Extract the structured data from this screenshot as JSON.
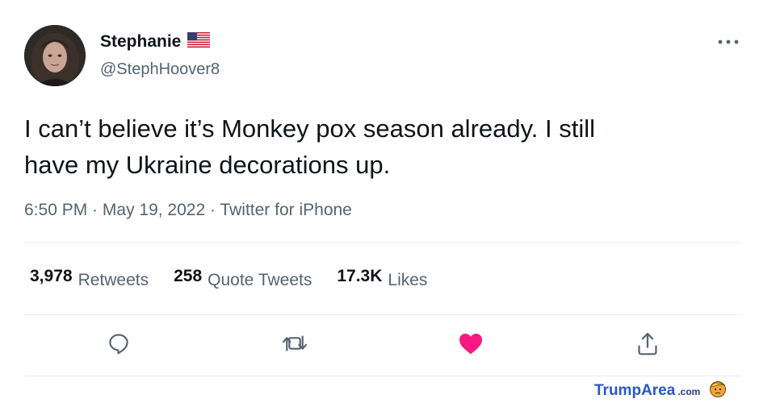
{
  "tweet": {
    "author": {
      "name": "Stephanie",
      "handle": "@StephHoover8"
    },
    "text_line1": "I can’t believe it’s Monkey pox season already. I still",
    "text_line2": "have my Ukraine decorations up.",
    "time": "6:50 PM",
    "date": "May 19, 2022",
    "source": "Twitter for iPhone",
    "separator": " · "
  },
  "stats": {
    "retweets": {
      "count": "3,978",
      "label": "Retweets"
    },
    "quotes": {
      "count": "258",
      "label": "Quote Tweets"
    },
    "likes": {
      "count": "17.3K",
      "label": "Likes"
    }
  },
  "actions": [
    "reply-icon",
    "retweet-icon",
    "like-icon",
    "share-icon"
  ],
  "watermark": {
    "part1": "Trump",
    "part2": "Area",
    "part3": ".com"
  },
  "colors": {
    "like_active": "#f91880",
    "secondary_text": "#536471",
    "icon": "#536471"
  }
}
